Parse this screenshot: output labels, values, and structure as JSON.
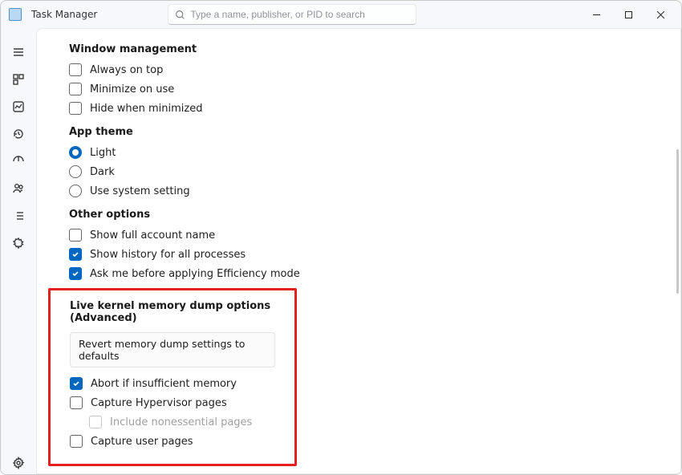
{
  "titlebar": {
    "app_title": "Task Manager",
    "search_placeholder": "Type a name, publisher, or PID to search"
  },
  "sections": {
    "window_mgmt": {
      "title": "Window management",
      "always_on_top": "Always on top",
      "minimize_on_use": "Minimize on use",
      "hide_when_minimized": "Hide when minimized"
    },
    "app_theme": {
      "title": "App theme",
      "light": "Light",
      "dark": "Dark",
      "use_system": "Use system setting"
    },
    "other": {
      "title": "Other options",
      "full_account": "Show full account name",
      "history_all": "Show history for all processes",
      "ask_efficiency": "Ask me before applying Efficiency mode"
    },
    "kernel": {
      "title": "Live kernel memory dump options (Advanced)",
      "revert": "Revert memory dump settings to defaults",
      "abort": "Abort if insufficient memory",
      "hypervisor": "Capture Hypervisor pages",
      "nonessential": "Include nonessential pages",
      "user_pages": "Capture user pages"
    }
  }
}
